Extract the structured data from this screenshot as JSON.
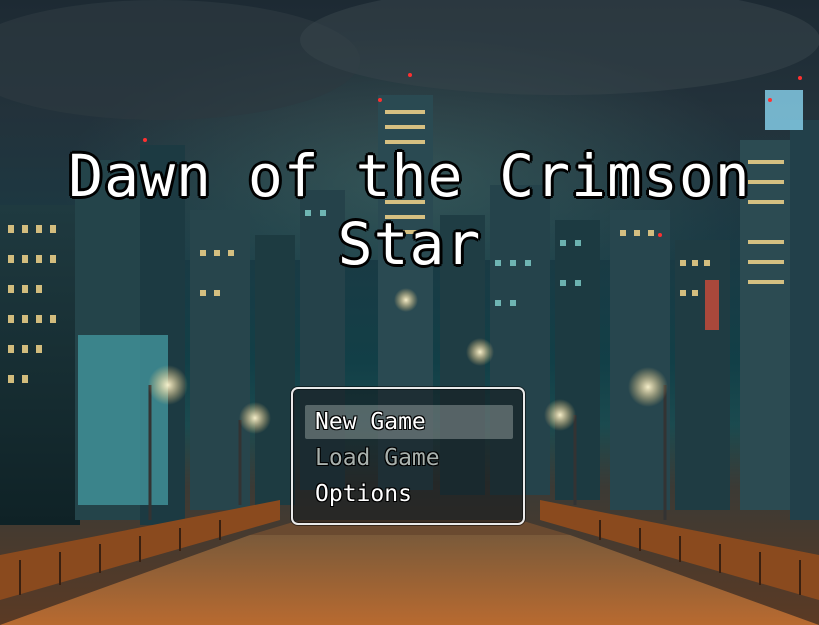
{
  "game": {
    "title": "Dawn of the Crimson Star",
    "menu": {
      "items": [
        {
          "label": "New Game",
          "state": "selected"
        },
        {
          "label": "Load Game",
          "state": "disabled"
        },
        {
          "label": "Options",
          "state": "enabled"
        }
      ]
    }
  },
  "colors": {
    "title_text": "#ffffff",
    "menu_border": "#e9e9e9",
    "menu_disabled_text": "#a9b1ad"
  }
}
